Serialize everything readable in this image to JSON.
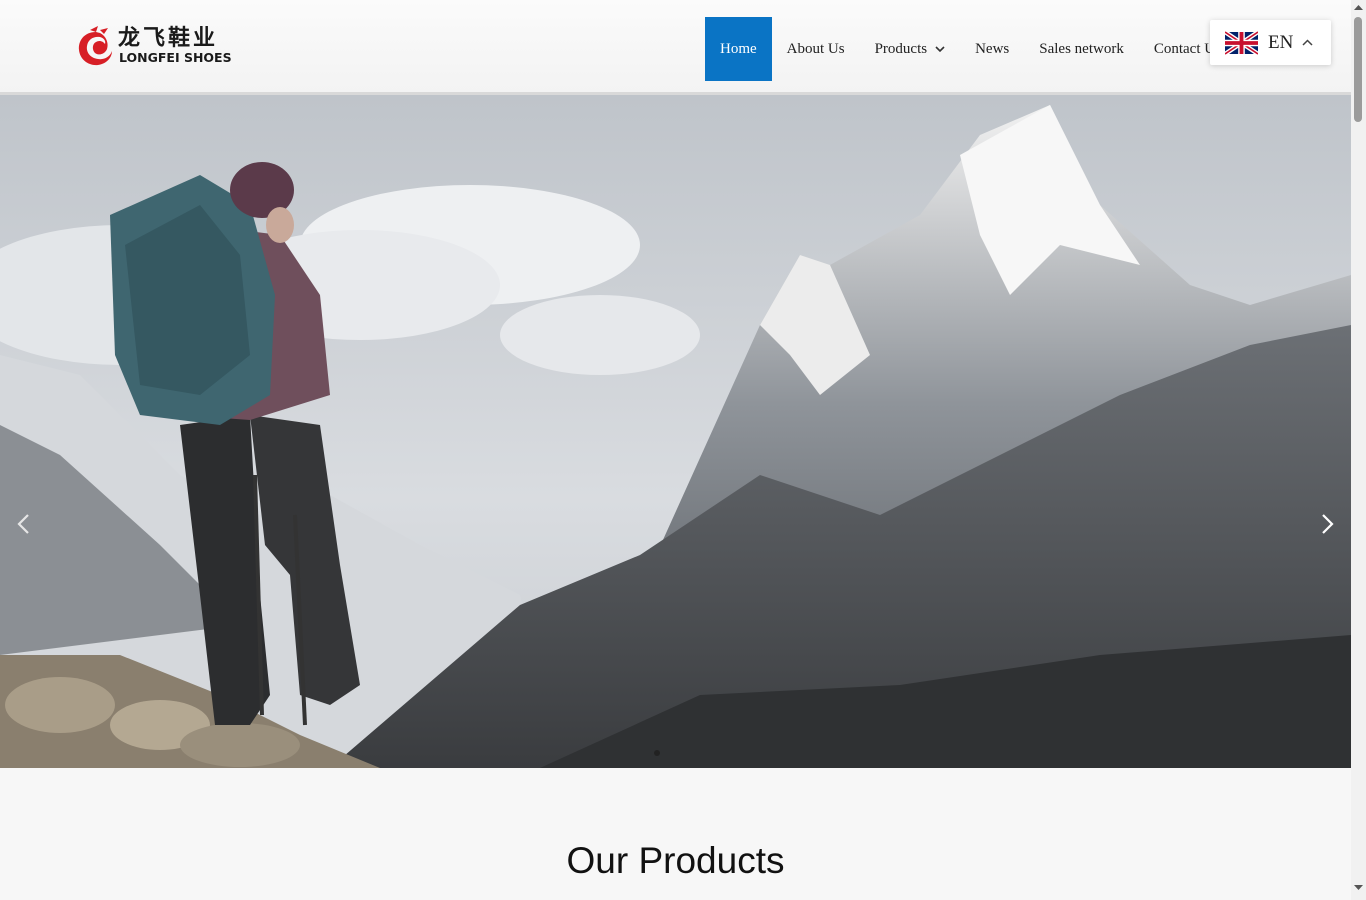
{
  "logo": {
    "text_cn": "龙飞鞋业",
    "text_en": "LONGFEI SHOES"
  },
  "nav": {
    "items": [
      {
        "label": "Home",
        "active": true
      },
      {
        "label": "About Us"
      },
      {
        "label": "Products",
        "has_dropdown": true
      },
      {
        "label": "News"
      },
      {
        "label": "Sales network"
      },
      {
        "label": "Contact Us"
      }
    ]
  },
  "language": {
    "code": "EN",
    "flag": "uk-flag-icon"
  },
  "hero": {
    "slide_count": 1,
    "current_slide": 1
  },
  "products": {
    "title": "Our Products"
  },
  "colors": {
    "accent": "#0a74c5",
    "logo_red": "#d71f26"
  }
}
